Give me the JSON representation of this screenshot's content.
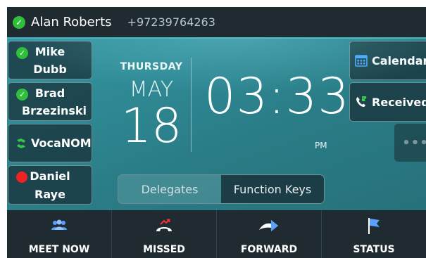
{
  "header": {
    "name": "Alan Roberts",
    "number": "+97239764263",
    "status_color": "#2fbf3a"
  },
  "left_keys": [
    {
      "line1": "Mike",
      "line2": "Dubb",
      "status": "available"
    },
    {
      "line1": "Brad",
      "line2": "Brzezinski",
      "status": "available"
    },
    {
      "label": "VocaNOM"
    },
    {
      "line1": "Daniel",
      "line2": "Raye",
      "status": "busy"
    }
  ],
  "right_keys": [
    {
      "label": "Calendar",
      "icon": "calendar-icon"
    },
    {
      "label": "Received",
      "icon": "received-call-icon"
    }
  ],
  "more_label": "•••",
  "clock": {
    "day": "THURSDAY",
    "month": "MAY",
    "date": "18",
    "time": "03:33",
    "ampm": "PM"
  },
  "tabs": [
    {
      "label": "Delegates",
      "active": true
    },
    {
      "label": "Function Keys",
      "active": false
    }
  ],
  "softkeys": [
    {
      "label": "MEET NOW",
      "icon": "meet-now-icon"
    },
    {
      "label": "MISSED",
      "icon": "missed-call-icon"
    },
    {
      "label": "FORWARD",
      "icon": "forward-icon"
    },
    {
      "label": "STATUS",
      "icon": "status-flag-icon"
    }
  ],
  "colors": {
    "accent": "#3fb4c0",
    "available": "#2fbf3a",
    "busy": "#ee2222",
    "bar": "#1f2b31"
  }
}
